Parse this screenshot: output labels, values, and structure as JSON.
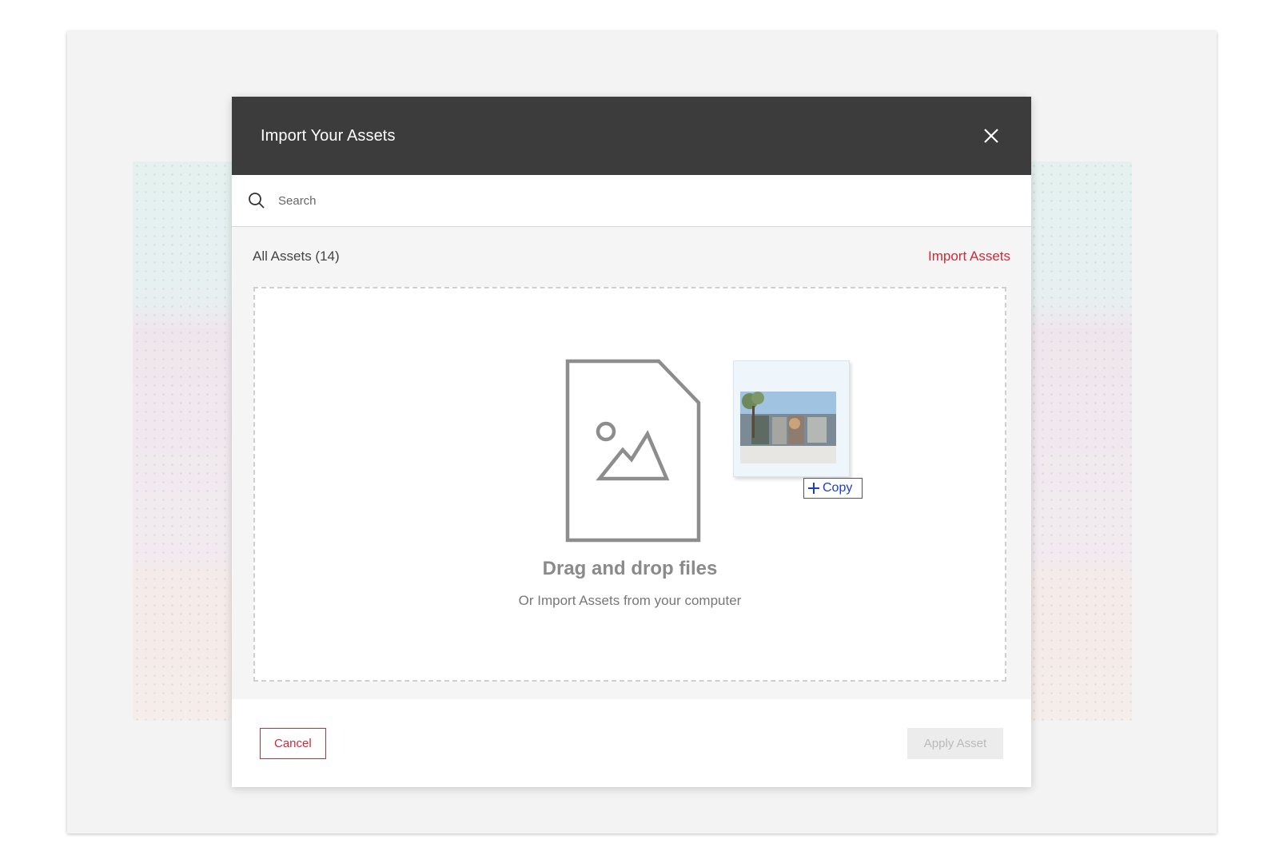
{
  "dialog": {
    "title": "Import Your Assets",
    "close_icon": "close-icon"
  },
  "search": {
    "placeholder": "Search",
    "value": "",
    "icon": "search-icon"
  },
  "assets": {
    "count_label": "All Assets (14)",
    "import_link": "Import Assets"
  },
  "dropzone": {
    "icon": "image-file-icon",
    "title": "Drag and drop files",
    "subtitle": "Or Import Assets from your computer",
    "drag_preview": {
      "icon": "plus-icon",
      "copy_label": "Copy"
    }
  },
  "footer": {
    "cancel_label": "Cancel",
    "apply_label": "Apply Asset",
    "apply_disabled": true
  },
  "colors": {
    "accent": "#d0293a",
    "header_bg": "#3c3c3c",
    "copy_blue": "#1a3fc7"
  }
}
